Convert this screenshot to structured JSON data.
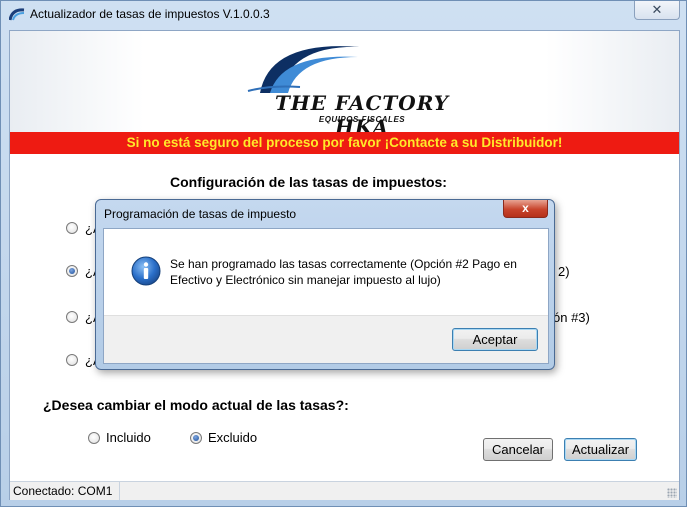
{
  "window": {
    "title": "Actualizador de tasas de impuestos V.1.0.0.3",
    "close_glyph": "✕",
    "icon": "app-arc-icon"
  },
  "banner": {
    "logo_text": "The Factory HKA",
    "logo_subtext": "EQUIPOS FISCALES",
    "warning": "Si no está seguro del proceso por favor ¡Contacte a su Distribuidor!"
  },
  "config": {
    "title": "Configuración de las tasas de impuestos:",
    "options": [
      {
        "visible_start": "¿A",
        "visible_end": "",
        "checked": false
      },
      {
        "visible_start": "¿A",
        "visible_end": "2)",
        "checked": true
      },
      {
        "visible_start": "¿A",
        "visible_end": "ón #3)",
        "checked": false
      },
      {
        "visible_start": "¿A",
        "visible_end": "",
        "checked": false
      }
    ]
  },
  "mode": {
    "question": "¿Desea cambiar el modo actual de las tasas?:",
    "incluido": "Incluido",
    "excluido": "Excluido",
    "selected": "Excluido"
  },
  "buttons": {
    "cancel": "Cancelar",
    "update": "Actualizar"
  },
  "status": {
    "connected": "Conectado:  COM1"
  },
  "dialog": {
    "title": "Programación de tasas de impuesto",
    "close_glyph": "x",
    "icon": "info-icon",
    "message": "Se han programado las tasas correctamente (Opción #2 Pago en Efectivo y Electrónico sin manejar impuesto al lujo)",
    "ok": "Aceptar"
  },
  "colors": {
    "warning_bg": "#ee1b12",
    "warning_text": "#ffe92a",
    "title_bar": "#c4d8ef",
    "logo_blue": "#1a4ea0"
  }
}
